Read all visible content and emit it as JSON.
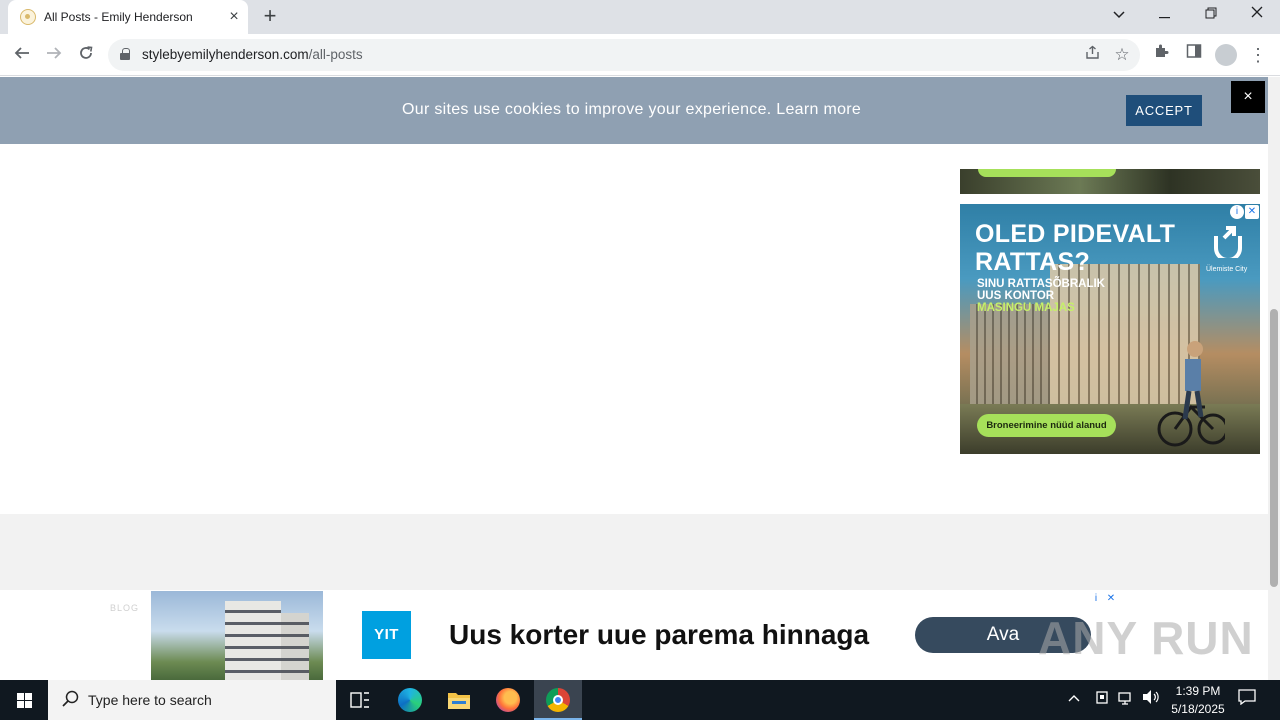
{
  "browser": {
    "tab_title": "All Posts - Emily Henderson",
    "tab_close": "×",
    "new_tab": "+",
    "url_host": "stylebyemilyhenderson.com",
    "url_path": "/all-posts"
  },
  "cookie_banner": {
    "message": "Our sites use cookies to improve your experience. Learn more",
    "accept_label": "ACCEPT",
    "close_label": "×"
  },
  "side_ad": {
    "headline_line1": "OLED PIDEVALT",
    "headline_line2": "RATTAS?",
    "sub_line1": "SINU RATTASÕBRALIK",
    "sub_line2": "UUS KONTOR",
    "sub_line3": "MASINGU MAJAS",
    "brand": "Ülemiste City",
    "cta": "Broneerimine nüüd alanud"
  },
  "footer": {
    "blog_label": "BLOG"
  },
  "bottom_ad": {
    "logo": "YIT",
    "text": "Uus korter uue parema hinnaga",
    "cta": "Ava"
  },
  "watermark": "ANY RUN",
  "taskbar": {
    "search_placeholder": "Type here to search",
    "time": "1:39 PM",
    "date": "5/18/2025"
  },
  "colors": {
    "cookie_bar": "#8fa0b2",
    "accept_button": "#1f4e7a",
    "ad_cta_green": "#a6e05a",
    "yit_blue": "#00a0e0"
  }
}
